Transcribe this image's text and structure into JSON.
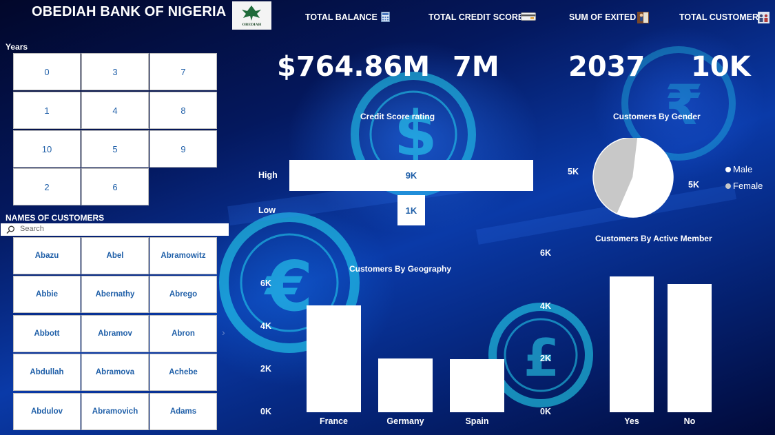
{
  "brand": {
    "title": "OBEDIAH BANK OF NIGERIA",
    "logo_text": "OBEDIAH"
  },
  "colors": {
    "tile_text": "#1f5fa8",
    "tile_bg": "#ffffff",
    "female_slice": "#c8c8c8",
    "male_slice": "#ffffff"
  },
  "kpis": [
    {
      "label": "TOTAL BALANCE",
      "value": "$764.86M",
      "icon": "calculator-icon"
    },
    {
      "label": "TOTAL CREDIT SCORE",
      "value": "7M",
      "icon": "credit-card-icon"
    },
    {
      "label": "SUM OF EXITED",
      "value": "2037",
      "icon": "person-exit-icon"
    },
    {
      "label": "TOTAL CUSTOMER",
      "value": "10K",
      "icon": "people-icon"
    }
  ],
  "years": {
    "title": "Years",
    "items": [
      "0",
      "3",
      "7",
      "1",
      "4",
      "8",
      "10",
      "5",
      "9",
      "2",
      "6"
    ]
  },
  "customers": {
    "title": "NAMES OF CUSTOMERS",
    "search_placeholder": "Search",
    "names": [
      "Abazu",
      "Abel",
      "Abramowitz",
      "Abbie",
      "Abernathy",
      "Abrego",
      "Abbott",
      "Abramov",
      "Abron",
      "Abdullah",
      "Abramova",
      "Achebe",
      "Abdulov",
      "Abramovich",
      "Adams"
    ]
  },
  "charts": {
    "credit": {
      "title": "Credit Score rating"
    },
    "gender": {
      "title": "Customers By Gender"
    },
    "geography": {
      "title": "Customers By Geography"
    },
    "active": {
      "title": "Customers By Active Member"
    }
  },
  "chart_data": [
    {
      "type": "bar",
      "orientation": "horizontal",
      "title": "Credit Score rating",
      "categories": [
        "High",
        "Low"
      ],
      "values": [
        9000,
        1000
      ],
      "data_labels": [
        "9K",
        "1K"
      ]
    },
    {
      "type": "pie",
      "title": "Customers By Gender",
      "categories": [
        "Male",
        "Female"
      ],
      "values": [
        5457,
        4543
      ],
      "data_labels": [
        "5K",
        "5K"
      ],
      "legend": "right"
    },
    {
      "type": "bar",
      "title": "Customers By Geography",
      "categories": [
        "France",
        "Germany",
        "Spain"
      ],
      "values": [
        5014,
        2509,
        2477
      ],
      "ylim": [
        0,
        6000
      ],
      "yticks": [
        "0K",
        "2K",
        "4K",
        "6K"
      ]
    },
    {
      "type": "bar",
      "title": "Customers By Active Member",
      "categories": [
        "Yes",
        "No"
      ],
      "values": [
        5151,
        4849
      ],
      "ylim": [
        0,
        6000
      ],
      "yticks": [
        "0K",
        "2K",
        "4K",
        "6K"
      ]
    }
  ]
}
